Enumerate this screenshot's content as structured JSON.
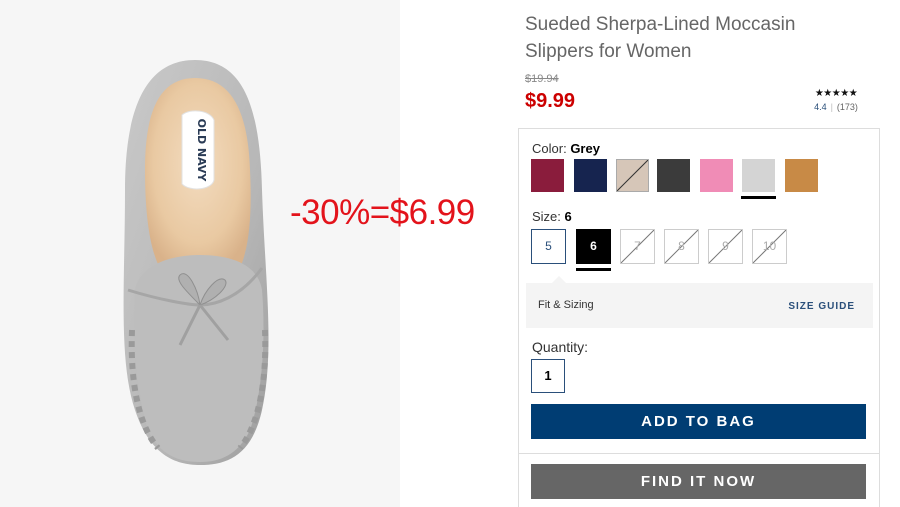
{
  "product": {
    "title": "Sueded Sherpa-Lined Moccasin Slippers for Women",
    "original_price": "$19.94",
    "sale_price": "$9.99",
    "insole_logo": "OLD NAVY"
  },
  "promo_overlay": "-30%=$6.99",
  "rating": {
    "stars": "★★★★★",
    "value": "4.4",
    "count": "(173)",
    "value_out_of_5": 4.4
  },
  "color": {
    "label": "Color:",
    "selected": "Grey",
    "swatches": [
      {
        "name": "burgundy",
        "hex": "#8a1c3c",
        "available": true
      },
      {
        "name": "navy",
        "hex": "#16244f",
        "available": true
      },
      {
        "name": "taupe",
        "hex": "#d6c6b8",
        "available": false
      },
      {
        "name": "charcoal",
        "hex": "#3b3b3b",
        "available": true
      },
      {
        "name": "pink",
        "hex": "#f08cb6",
        "available": true
      },
      {
        "name": "grey",
        "hex": "#d4d4d4",
        "available": true,
        "selected": true
      },
      {
        "name": "tan",
        "hex": "#c88a46",
        "available": true
      }
    ]
  },
  "size": {
    "label": "Size:",
    "selected": "6",
    "options": [
      {
        "label": "5",
        "available": true
      },
      {
        "label": "6",
        "available": true,
        "selected": true
      },
      {
        "label": "7",
        "available": false
      },
      {
        "label": "8",
        "available": false
      },
      {
        "label": "9",
        "available": false
      },
      {
        "label": "10",
        "available": false
      }
    ]
  },
  "fit": {
    "label": "Fit & Sizing",
    "size_guide": "SIZE GUIDE"
  },
  "quantity": {
    "label": "Quantity:",
    "value": "1"
  },
  "buttons": {
    "add_to_bag": "ADD TO BAG",
    "find_it_now": "FIND IT NOW"
  },
  "colors": {
    "accent_blue": "#003d73",
    "sale_red": "#cc0000",
    "promo_red": "#e3131b"
  }
}
